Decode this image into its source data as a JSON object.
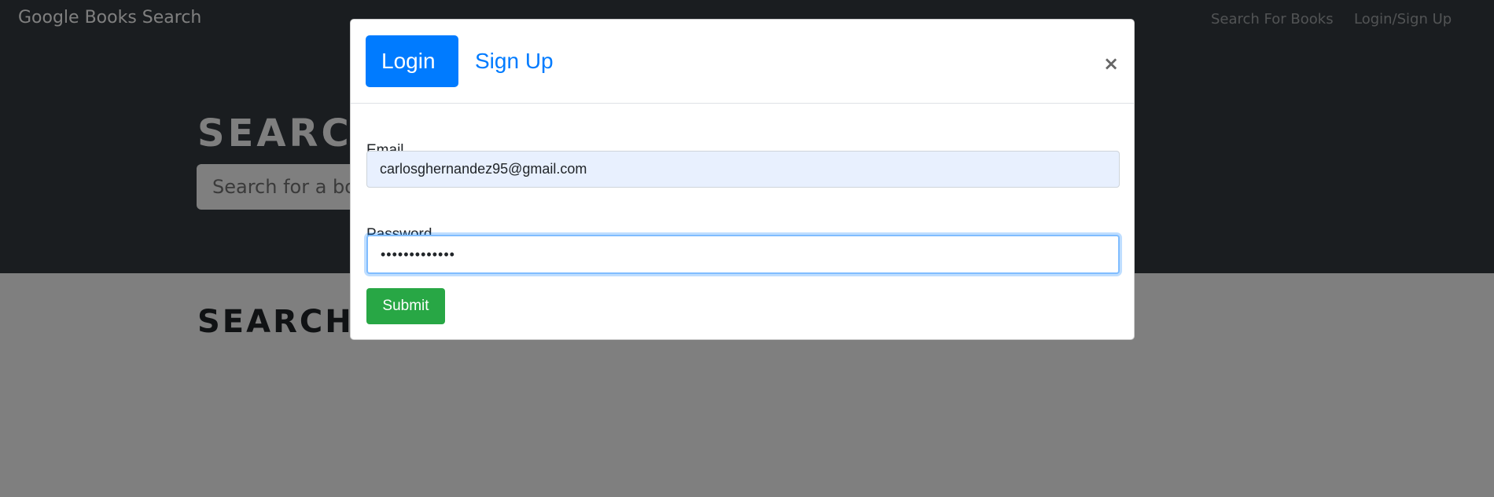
{
  "navbar": {
    "brand": "Google Books Search",
    "links": [
      {
        "label": "Search For Books"
      },
      {
        "label": "Login/Sign Up"
      }
    ]
  },
  "hero": {
    "title": "SEARCH FOR BOOKS!",
    "search_placeholder": "Search for a book"
  },
  "results": {
    "title": "SEARCH FOR A BOOK TO BEGIN"
  },
  "modal": {
    "tabs": [
      {
        "label": "Login",
        "active": true
      },
      {
        "label": "Sign Up",
        "active": false
      }
    ],
    "close_label": "×",
    "email": {
      "label": "Email",
      "value": "carlosghernandez95@gmail.com"
    },
    "password": {
      "label": "Password",
      "value": "•••••••••••••"
    },
    "submit_label": "Submit"
  },
  "colors": {
    "dark_bg": "#343a40",
    "primary": "#007bff",
    "success": "#28a745",
    "autofill": "#e8f0fe"
  }
}
